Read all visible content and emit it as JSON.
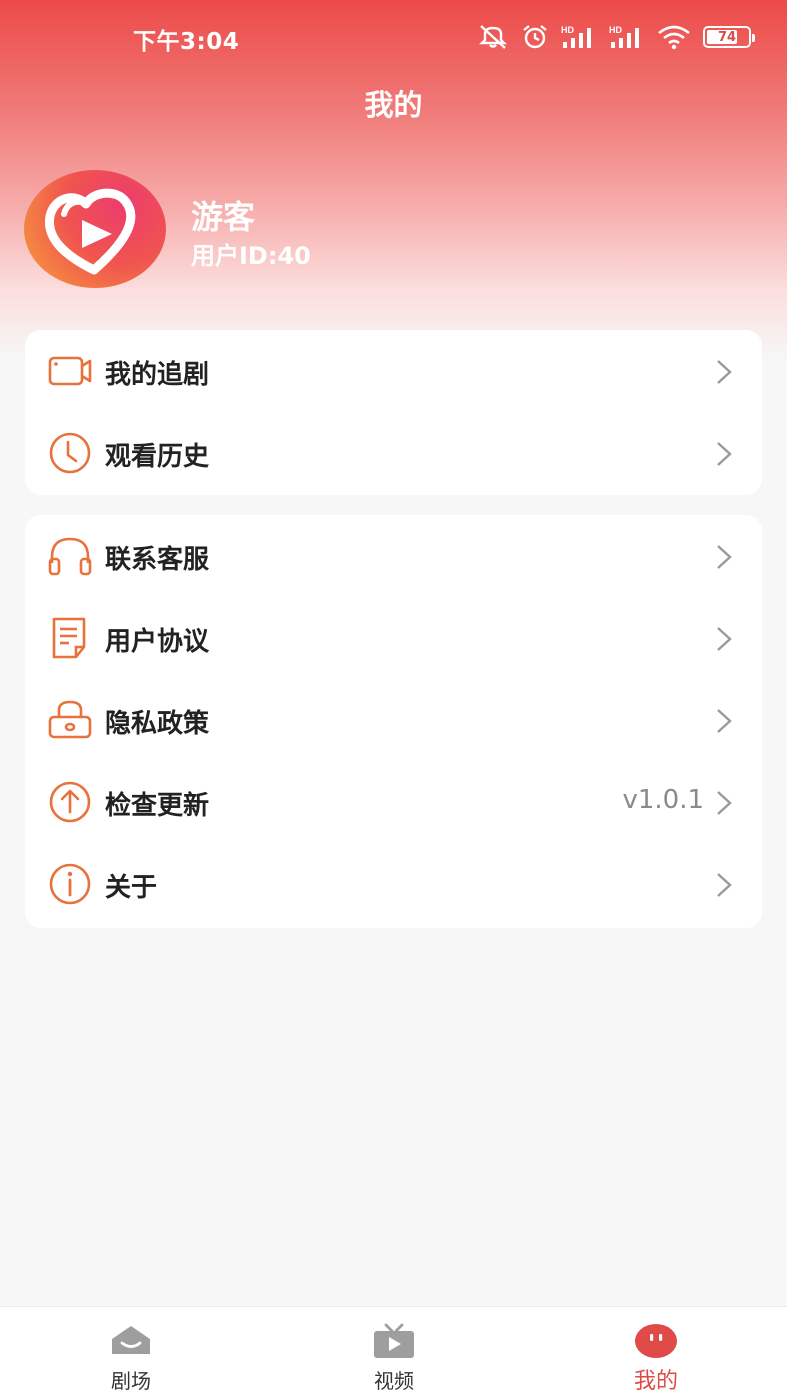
{
  "status_bar": {
    "time": "下午3:04",
    "battery_level": 74,
    "battery_label": "74",
    "network_labels": [
      "HD",
      "HD"
    ],
    "icons": [
      "mute-icon",
      "alarm-icon",
      "signal-1-icon",
      "signal-2-icon",
      "wifi-icon",
      "battery-icon"
    ]
  },
  "header": {
    "title": "我的"
  },
  "profile": {
    "name": "游客",
    "user_id": "用户ID:40",
    "avatar_icon": "app-logo-icon"
  },
  "menu_group_1": [
    {
      "label": "我的追剧",
      "icon": "video-camera-icon"
    },
    {
      "label": "观看历史",
      "icon": "clock-icon"
    }
  ],
  "menu_group_2": [
    {
      "label": "联系客服",
      "icon": "headphones-icon"
    },
    {
      "label": "用户协议",
      "icon": "document-icon"
    },
    {
      "label": "隐私政策",
      "icon": "lock-icon"
    },
    {
      "label": "检查更新",
      "icon": "upload-arrow-icon",
      "value": "v1.0.1"
    },
    {
      "label": "关于",
      "icon": "info-icon"
    }
  ],
  "tabbar": {
    "tabs": [
      {
        "label": "剧场",
        "icon": "theater-icon",
        "active": false
      },
      {
        "label": "视频",
        "icon": "tv-icon",
        "active": false
      },
      {
        "label": "我的",
        "icon": "profile-face-icon",
        "active": true
      }
    ]
  },
  "colors": {
    "accent": "#ec4a48",
    "icon_orange": "#e8713c",
    "active_tab": "#e04a48",
    "background": "#f7f7f7"
  }
}
